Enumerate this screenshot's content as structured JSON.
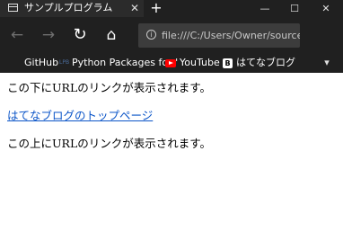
{
  "tab": {
    "title": "サンプルプログラム",
    "close": "✕"
  },
  "new_tab_symbol": "+",
  "window_controls": {
    "minimize": "—",
    "maximize": "☐",
    "close": "✕"
  },
  "nav": {
    "back": "←",
    "forward": "→",
    "refresh": "↻",
    "home": "⌂"
  },
  "address": {
    "info_icon": "i",
    "url": "file:///C:/Users/Owner/source/re"
  },
  "favorites": [
    {
      "label": "GitHub",
      "icon": "none"
    },
    {
      "label": "Python Packages for '",
      "icon": "pypi-icon",
      "icon_text": "LPB"
    },
    {
      "label": "YouTube",
      "icon": "youtube-icon"
    },
    {
      "label": "はてなブログ",
      "icon": "hatena-blog-icon",
      "icon_text": "B"
    }
  ],
  "favorites_overflow": "▾",
  "content": {
    "line1": "この下にURLのリンクが表示されます。",
    "link": "はてなブログのトップページ",
    "line2": "この上にURLのリンクが表示されます。"
  },
  "colors": {
    "chrome_bg": "#202020",
    "tab_bg": "#2b2b2b",
    "address_bg": "#3c3c3c",
    "link": "#0b55c8"
  }
}
